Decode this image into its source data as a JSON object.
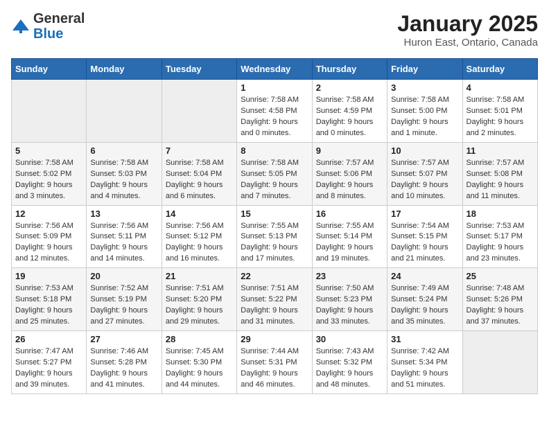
{
  "header": {
    "logo_general": "General",
    "logo_blue": "Blue",
    "month_title": "January 2025",
    "location": "Huron East, Ontario, Canada"
  },
  "days_of_week": [
    "Sunday",
    "Monday",
    "Tuesday",
    "Wednesday",
    "Thursday",
    "Friday",
    "Saturday"
  ],
  "weeks": [
    [
      {
        "day": "",
        "empty": true
      },
      {
        "day": "",
        "empty": true
      },
      {
        "day": "",
        "empty": true
      },
      {
        "day": "1",
        "sunrise": "Sunrise: 7:58 AM",
        "sunset": "Sunset: 4:58 PM",
        "daylight": "Daylight: 9 hours and 0 minutes."
      },
      {
        "day": "2",
        "sunrise": "Sunrise: 7:58 AM",
        "sunset": "Sunset: 4:59 PM",
        "daylight": "Daylight: 9 hours and 0 minutes."
      },
      {
        "day": "3",
        "sunrise": "Sunrise: 7:58 AM",
        "sunset": "Sunset: 5:00 PM",
        "daylight": "Daylight: 9 hours and 1 minute."
      },
      {
        "day": "4",
        "sunrise": "Sunrise: 7:58 AM",
        "sunset": "Sunset: 5:01 PM",
        "daylight": "Daylight: 9 hours and 2 minutes."
      }
    ],
    [
      {
        "day": "5",
        "sunrise": "Sunrise: 7:58 AM",
        "sunset": "Sunset: 5:02 PM",
        "daylight": "Daylight: 9 hours and 3 minutes."
      },
      {
        "day": "6",
        "sunrise": "Sunrise: 7:58 AM",
        "sunset": "Sunset: 5:03 PM",
        "daylight": "Daylight: 9 hours and 4 minutes."
      },
      {
        "day": "7",
        "sunrise": "Sunrise: 7:58 AM",
        "sunset": "Sunset: 5:04 PM",
        "daylight": "Daylight: 9 hours and 6 minutes."
      },
      {
        "day": "8",
        "sunrise": "Sunrise: 7:58 AM",
        "sunset": "Sunset: 5:05 PM",
        "daylight": "Daylight: 9 hours and 7 minutes."
      },
      {
        "day": "9",
        "sunrise": "Sunrise: 7:57 AM",
        "sunset": "Sunset: 5:06 PM",
        "daylight": "Daylight: 9 hours and 8 minutes."
      },
      {
        "day": "10",
        "sunrise": "Sunrise: 7:57 AM",
        "sunset": "Sunset: 5:07 PM",
        "daylight": "Daylight: 9 hours and 10 minutes."
      },
      {
        "day": "11",
        "sunrise": "Sunrise: 7:57 AM",
        "sunset": "Sunset: 5:08 PM",
        "daylight": "Daylight: 9 hours and 11 minutes."
      }
    ],
    [
      {
        "day": "12",
        "sunrise": "Sunrise: 7:56 AM",
        "sunset": "Sunset: 5:09 PM",
        "daylight": "Daylight: 9 hours and 12 minutes."
      },
      {
        "day": "13",
        "sunrise": "Sunrise: 7:56 AM",
        "sunset": "Sunset: 5:11 PM",
        "daylight": "Daylight: 9 hours and 14 minutes."
      },
      {
        "day": "14",
        "sunrise": "Sunrise: 7:56 AM",
        "sunset": "Sunset: 5:12 PM",
        "daylight": "Daylight: 9 hours and 16 minutes."
      },
      {
        "day": "15",
        "sunrise": "Sunrise: 7:55 AM",
        "sunset": "Sunset: 5:13 PM",
        "daylight": "Daylight: 9 hours and 17 minutes."
      },
      {
        "day": "16",
        "sunrise": "Sunrise: 7:55 AM",
        "sunset": "Sunset: 5:14 PM",
        "daylight": "Daylight: 9 hours and 19 minutes."
      },
      {
        "day": "17",
        "sunrise": "Sunrise: 7:54 AM",
        "sunset": "Sunset: 5:15 PM",
        "daylight": "Daylight: 9 hours and 21 minutes."
      },
      {
        "day": "18",
        "sunrise": "Sunrise: 7:53 AM",
        "sunset": "Sunset: 5:17 PM",
        "daylight": "Daylight: 9 hours and 23 minutes."
      }
    ],
    [
      {
        "day": "19",
        "sunrise": "Sunrise: 7:53 AM",
        "sunset": "Sunset: 5:18 PM",
        "daylight": "Daylight: 9 hours and 25 minutes."
      },
      {
        "day": "20",
        "sunrise": "Sunrise: 7:52 AM",
        "sunset": "Sunset: 5:19 PM",
        "daylight": "Daylight: 9 hours and 27 minutes."
      },
      {
        "day": "21",
        "sunrise": "Sunrise: 7:51 AM",
        "sunset": "Sunset: 5:20 PM",
        "daylight": "Daylight: 9 hours and 29 minutes."
      },
      {
        "day": "22",
        "sunrise": "Sunrise: 7:51 AM",
        "sunset": "Sunset: 5:22 PM",
        "daylight": "Daylight: 9 hours and 31 minutes."
      },
      {
        "day": "23",
        "sunrise": "Sunrise: 7:50 AM",
        "sunset": "Sunset: 5:23 PM",
        "daylight": "Daylight: 9 hours and 33 minutes."
      },
      {
        "day": "24",
        "sunrise": "Sunrise: 7:49 AM",
        "sunset": "Sunset: 5:24 PM",
        "daylight": "Daylight: 9 hours and 35 minutes."
      },
      {
        "day": "25",
        "sunrise": "Sunrise: 7:48 AM",
        "sunset": "Sunset: 5:26 PM",
        "daylight": "Daylight: 9 hours and 37 minutes."
      }
    ],
    [
      {
        "day": "26",
        "sunrise": "Sunrise: 7:47 AM",
        "sunset": "Sunset: 5:27 PM",
        "daylight": "Daylight: 9 hours and 39 minutes."
      },
      {
        "day": "27",
        "sunrise": "Sunrise: 7:46 AM",
        "sunset": "Sunset: 5:28 PM",
        "daylight": "Daylight: 9 hours and 41 minutes."
      },
      {
        "day": "28",
        "sunrise": "Sunrise: 7:45 AM",
        "sunset": "Sunset: 5:30 PM",
        "daylight": "Daylight: 9 hours and 44 minutes."
      },
      {
        "day": "29",
        "sunrise": "Sunrise: 7:44 AM",
        "sunset": "Sunset: 5:31 PM",
        "daylight": "Daylight: 9 hours and 46 minutes."
      },
      {
        "day": "30",
        "sunrise": "Sunrise: 7:43 AM",
        "sunset": "Sunset: 5:32 PM",
        "daylight": "Daylight: 9 hours and 48 minutes."
      },
      {
        "day": "31",
        "sunrise": "Sunrise: 7:42 AM",
        "sunset": "Sunset: 5:34 PM",
        "daylight": "Daylight: 9 hours and 51 minutes."
      },
      {
        "day": "",
        "empty": true
      }
    ]
  ]
}
